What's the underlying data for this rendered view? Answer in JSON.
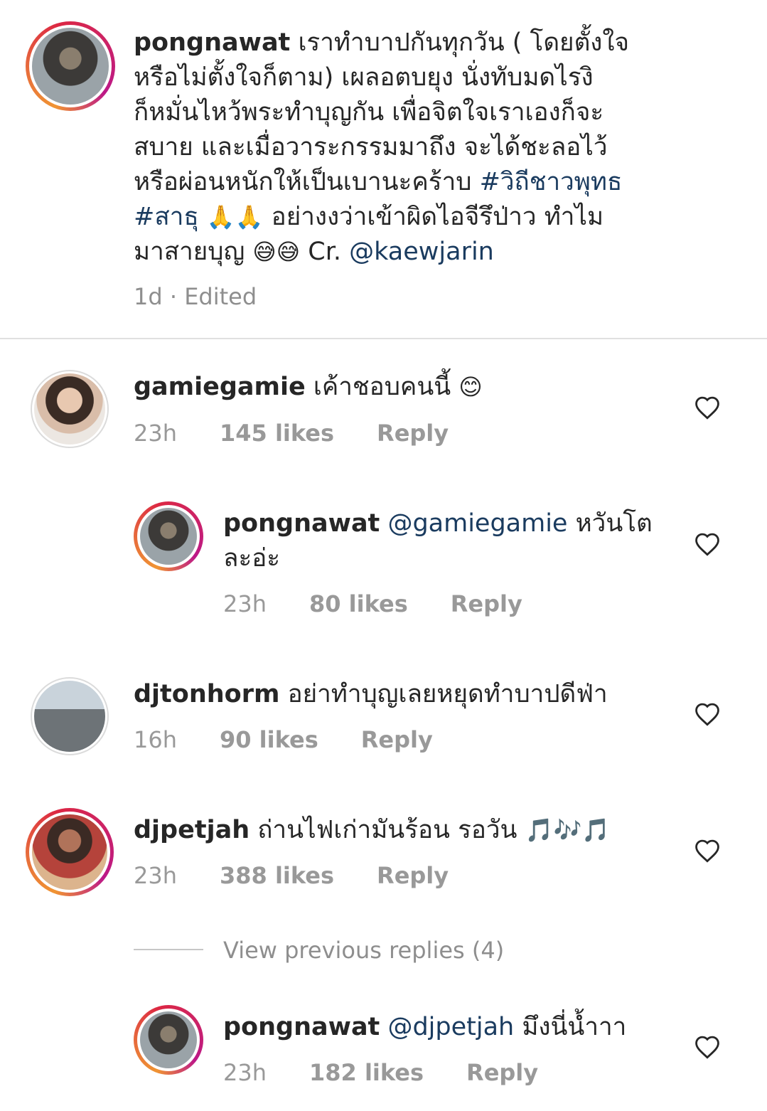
{
  "post": {
    "username": "pongnawat",
    "caption_lines": [
      "เราทำบาปกันทุกวัน ( โดยตั้งใจ",
      "หรือไม่ตั้งใจก็ตาม) เผลอตบยุง นั่งทับมดไรงิ",
      "ก็หมั่นไหว้พระทำบุญกัน เพื่อจิตใจเราเองก็จะ",
      "สบาย และเมื่อวาระกรรมมาถึง จะได้ชะลอไว้",
      "หรือผ่อนหนักให้เป็นเบานะคร้าบ "
    ],
    "hashtag_1": "#วิถีชาวพุทธ",
    "hashtag_2": "#สาธุ",
    "pray_emojis": "🙏🙏",
    "line7_text": " อย่างงว่าเข้าผิดไอจีรึป่าว ทำไม",
    "line8_text": "มาสายบุญ ",
    "sweat_emojis": "😅😅",
    "credit": " Cr. ",
    "credit_mention": "@kaewjarin",
    "meta": "1d · Edited"
  },
  "comments": [
    {
      "username": "gamiegamie",
      "text": " เค้าชอบคนนี้ ",
      "emoji": "😊",
      "time": "23h",
      "likes": "145 likes",
      "reply": "Reply"
    },
    {
      "username": "pongnawat",
      "mention": "@gamiegamie",
      "text_1": " หวันโต",
      "text_2": "ละอ่ะ",
      "time": "23h",
      "likes": "80 likes",
      "reply": "Reply"
    },
    {
      "username": "djtonhorm",
      "text": " อย่าทำบุญเลยหยุดทำบาปดีฟ่า",
      "time": "16h",
      "likes": "90 likes",
      "reply": "Reply"
    },
    {
      "username": "djpetjah",
      "text": " ถ่านไฟเก่ามันร้อน รอวัน ",
      "emoji": "🎵🎶🎵",
      "time": "23h",
      "likes": "388 likes",
      "reply": "Reply"
    },
    {
      "view_previous": "View previous replies (4)"
    },
    {
      "username": "pongnawat",
      "mention": "@djpetjah",
      "text": " มึงนี่น้ำาา",
      "time": "23h",
      "likes": "182 likes",
      "reply": "Reply"
    }
  ]
}
